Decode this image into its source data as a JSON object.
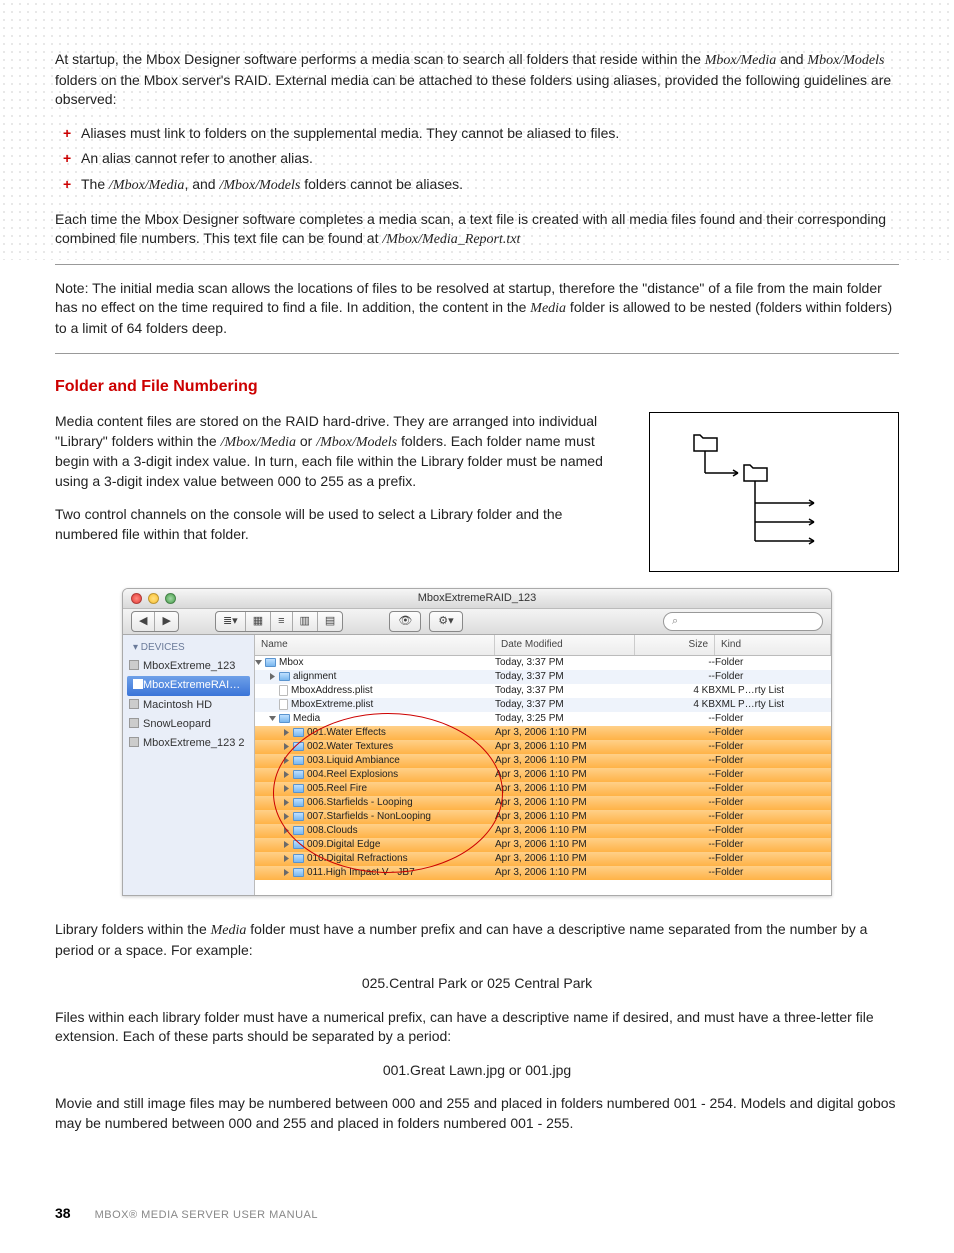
{
  "para1_a": "At startup, the Mbox Designer software performs a media scan to search all folders that reside within the ",
  "para1_i1": "Mbox/Media",
  "para1_b": " and ",
  "para1_i2": "Mbox/Models",
  "para1_c": " folders on the Mbox server's RAID. External media can be attached to these folders using aliases, provided the following guidelines are observed:",
  "bullets": [
    "Aliases must link to folders on the supplemental media. They cannot be aliased to files.",
    "An alias cannot refer to another alias."
  ],
  "bullet3_a": "The ",
  "bullet3_i1": "/Mbox/Media",
  "bullet3_b": ", and ",
  "bullet3_i2": "/Mbox/Models",
  "bullet3_c": " folders cannot be aliases.",
  "para2_a": "Each time the Mbox Designer software completes a media scan, a text file is created with all media files found and their corresponding combined file numbers. This text file can be found at ",
  "para2_i": "/Mbox/Media_Report.txt",
  "note_lead": "Note:",
  "note_a": "  The initial media scan allows the locations of files to be resolved at startup, therefore the \"distance\" of a file from the main folder has no effect on the time required to find a file. In addition, the content in the ",
  "note_i": "Media",
  "note_b": " folder is allowed to be nested (folders within folders) to a limit of 64 folders deep.",
  "section_heading": "Folder and File Numbering",
  "sec_p1_a": "Media content files are stored on the RAID hard-drive. They are arranged into individual \"Library\" folders within the ",
  "sec_p1_i1": "/Mbox/Media",
  "sec_p1_b": " or ",
  "sec_p1_i2": "/Mbox/Models",
  "sec_p1_c": " folders. Each folder name must begin with a 3-digit index value. In turn, each file within the Library folder must be named using a 3-digit index value between 000 to 255 as a prefix.",
  "sec_p2": "Two control channels on the console will be used to select a Library folder and the numbered file within that folder.",
  "lib_p_a": "Library folders within the ",
  "lib_p_i": "Media",
  "lib_p_b": " folder must have a number prefix and can have a descriptive name separated from the number by a period or a space. For example:",
  "example1": "025.Central Park or 025 Central Park",
  "files_p": "Files within each library folder must have a numerical prefix, can have a descriptive name if desired, and must have a three-letter file extension. Each of these parts should be separated by a period:",
  "example2": "001.Great Lawn.jpg or 001.jpg",
  "range_p": "Movie and still image files may be numbered between 000 and 255 and placed in folders numbered 001 - 254. Models and digital gobos may be numbered between 000 and 255 and placed in folders numbered 001 - 255.",
  "page_number": "38",
  "footer_title": "MBOX® MEDIA SERVER USER MANUAL",
  "finder": {
    "title": "MboxExtremeRAID_123",
    "search_icon": "⌕",
    "eye": "👁",
    "gear": "⚙",
    "back": "◀",
    "fwd": "▶",
    "side_header": "▾ DEVICES",
    "devices": [
      "MboxExtreme_123",
      "MboxExtremeRAID_123",
      "Macintosh HD",
      "SnowLeopard",
      "MboxExtreme_123 2"
    ],
    "cols": {
      "name": "Name",
      "date": "Date Modified",
      "size": "Size",
      "kind": "Kind"
    },
    "rows": [
      {
        "name": "Mbox",
        "date": "Today, 3:37 PM",
        "size": "--",
        "kind": "Folder",
        "indent": 0,
        "folder": true,
        "open": true,
        "hl": false
      },
      {
        "name": "alignment",
        "date": "Today, 3:37 PM",
        "size": "--",
        "kind": "Folder",
        "indent": 1,
        "folder": true,
        "open": false,
        "hl": false,
        "alt": true
      },
      {
        "name": "MboxAddress.plist",
        "date": "Today, 3:37 PM",
        "size": "4 KB",
        "kind": "XML P…rty List",
        "indent": 1,
        "folder": false,
        "hl": false
      },
      {
        "name": "MboxExtreme.plist",
        "date": "Today, 3:37 PM",
        "size": "4 KB",
        "kind": "XML P…rty List",
        "indent": 1,
        "folder": false,
        "hl": false,
        "alt": true
      },
      {
        "name": "Media",
        "date": "Today, 3:25 PM",
        "size": "--",
        "kind": "Folder",
        "indent": 1,
        "folder": true,
        "open": true,
        "hl": false
      },
      {
        "name": "001.Water Effects",
        "date": "Apr 3, 2006 1:10 PM",
        "size": "--",
        "kind": "Folder",
        "indent": 2,
        "folder": true,
        "hl": true
      },
      {
        "name": "002.Water Textures",
        "date": "Apr 3, 2006 1:10 PM",
        "size": "--",
        "kind": "Folder",
        "indent": 2,
        "folder": true,
        "hl": true
      },
      {
        "name": "003.Liquid Ambiance",
        "date": "Apr 3, 2006 1:10 PM",
        "size": "--",
        "kind": "Folder",
        "indent": 2,
        "folder": true,
        "hl": true
      },
      {
        "name": "004.Reel Explosions",
        "date": "Apr 3, 2006 1:10 PM",
        "size": "--",
        "kind": "Folder",
        "indent": 2,
        "folder": true,
        "hl": true
      },
      {
        "name": "005.Reel Fire",
        "date": "Apr 3, 2006 1:10 PM",
        "size": "--",
        "kind": "Folder",
        "indent": 2,
        "folder": true,
        "hl": true
      },
      {
        "name": "006.Starfields - Looping",
        "date": "Apr 3, 2006 1:10 PM",
        "size": "--",
        "kind": "Folder",
        "indent": 2,
        "folder": true,
        "hl": true
      },
      {
        "name": "007.Starfields - NonLooping",
        "date": "Apr 3, 2006 1:10 PM",
        "size": "--",
        "kind": "Folder",
        "indent": 2,
        "folder": true,
        "hl": true
      },
      {
        "name": "008.Clouds",
        "date": "Apr 3, 2006 1:10 PM",
        "size": "--",
        "kind": "Folder",
        "indent": 2,
        "folder": true,
        "hl": true
      },
      {
        "name": "009.Digital Edge",
        "date": "Apr 3, 2006 1:10 PM",
        "size": "--",
        "kind": "Folder",
        "indent": 2,
        "folder": true,
        "hl": true
      },
      {
        "name": "010.Digital Refractions",
        "date": "Apr 3, 2006 1:10 PM",
        "size": "--",
        "kind": "Folder",
        "indent": 2,
        "folder": true,
        "hl": true
      },
      {
        "name": "011.High Impact V - JB7",
        "date": "Apr 3, 2006 1:10 PM",
        "size": "--",
        "kind": "Folder",
        "indent": 2,
        "folder": true,
        "hl": true
      }
    ]
  }
}
